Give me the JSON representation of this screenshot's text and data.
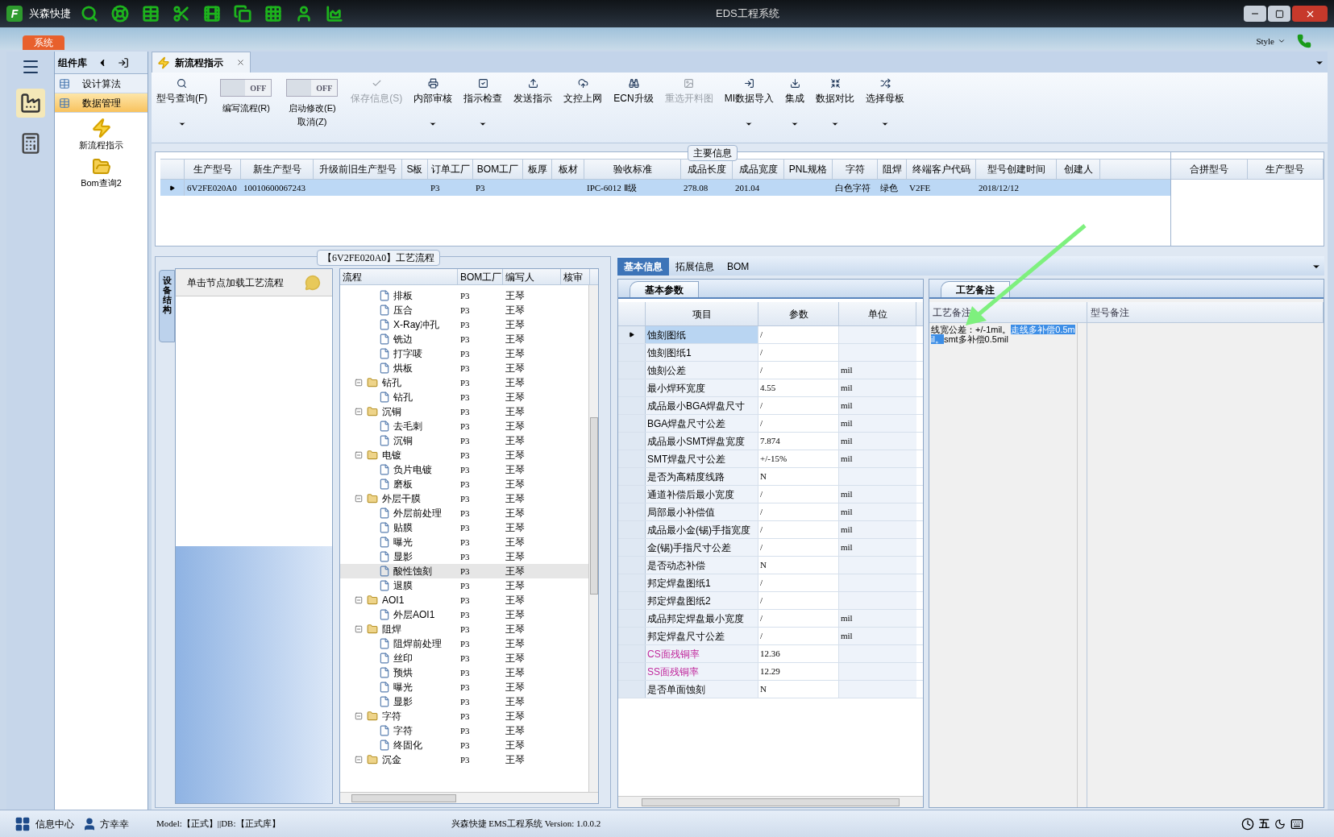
{
  "window": {
    "logo_text": "F",
    "app_name": "兴森快捷",
    "title": "EDS工程系统"
  },
  "menu": {
    "system_tab": "系统",
    "style_label": "Style"
  },
  "components": {
    "title": "组件库",
    "items": [
      {
        "label": "设计算法",
        "selected": false
      },
      {
        "label": "数据管理",
        "selected": true
      }
    ],
    "tools": [
      "新流程指示",
      "Bom查询2"
    ]
  },
  "doc_tab": {
    "label": "新流程指示"
  },
  "toolbar": [
    {
      "kind": "button",
      "label": "型号查询(F)",
      "disabled": false,
      "dropdown": true
    },
    {
      "kind": "toggle",
      "label": "编写流程(R)",
      "on": false,
      "state_text": "OFF"
    },
    {
      "kind": "toggle",
      "label": "启动修改(E)",
      "label2": "取消(Z)",
      "on": false,
      "state_text": "OFF"
    },
    {
      "kind": "button",
      "label": "保存信息(S)",
      "disabled": true,
      "dropdown": false
    },
    {
      "kind": "button",
      "label": "内部审核",
      "disabled": false,
      "dropdown": true
    },
    {
      "kind": "button",
      "label": "指示检查",
      "disabled": false,
      "dropdown": true
    },
    {
      "kind": "button",
      "label": "发送指示",
      "disabled": false,
      "dropdown": false
    },
    {
      "kind": "button",
      "label": "文控上网",
      "disabled": false,
      "dropdown": false
    },
    {
      "kind": "button",
      "label": "ECN升级",
      "disabled": false,
      "dropdown": false
    },
    {
      "kind": "button",
      "label": "重选开料图",
      "disabled": true,
      "dropdown": false
    },
    {
      "kind": "button",
      "label": "MI数据导入",
      "disabled": false,
      "dropdown": true
    },
    {
      "kind": "button",
      "label": "集成",
      "disabled": false,
      "dropdown": true
    },
    {
      "kind": "button",
      "label": "数据对比",
      "disabled": false,
      "dropdown": true
    },
    {
      "kind": "button",
      "label": "选择母板",
      "disabled": false,
      "dropdown": true
    }
  ],
  "main_info": {
    "title": "主要信息",
    "columns": [
      "生产型号",
      "新生产型号",
      "升级前旧生产型号",
      "S板",
      "订单工厂",
      "BOM工厂",
      "板厚",
      "板材",
      "验收标准",
      "成品长度",
      "成品宽度",
      "PNL规格",
      "字符",
      "阻焊",
      "终端客户代码",
      "型号创建时间",
      "创建人"
    ],
    "rows": [
      {
        "selected": true,
        "cells": [
          "6V2FE020A0",
          "10010600067243",
          null,
          null,
          "P3",
          "P3",
          null,
          null,
          "IPC-6012 Ⅱ级",
          "278.08",
          "201.04",
          null,
          "白色字符",
          "绿色",
          "V2FE",
          "2018/12/12",
          null
        ]
      }
    ],
    "side_columns": [
      "合拼型号",
      "生产型号"
    ]
  },
  "flow": {
    "title": "【6V2FE020A0】工艺流程",
    "side_tab": "设备结构",
    "hint": "单击节点加载工艺流程",
    "columns": [
      "流程",
      "BOM工厂",
      "编写人",
      "核审"
    ],
    "tree": [
      {
        "kind": "file",
        "label": "排板",
        "bom": "P3",
        "writer": "王琴",
        "selected": false
      },
      {
        "kind": "file",
        "label": "压合",
        "bom": "P3",
        "writer": "王琴",
        "selected": false
      },
      {
        "kind": "file",
        "label": "X-Ray冲孔",
        "bom": "P3",
        "writer": "王琴",
        "selected": false
      },
      {
        "kind": "file",
        "label": "铣边",
        "bom": "P3",
        "writer": "王琴",
        "selected": false
      },
      {
        "kind": "file",
        "label": "打字唛",
        "bom": "P3",
        "writer": "王琴",
        "selected": false
      },
      {
        "kind": "file",
        "label": "烘板",
        "bom": "P3",
        "writer": "王琴",
        "selected": false
      },
      {
        "kind": "folder",
        "label": "钻孔",
        "bom": "P3",
        "writer": "王琴",
        "selected": false,
        "expanded": true,
        "children": [
          {
            "kind": "file",
            "label": "钻孔",
            "bom": "P3",
            "writer": "王琴",
            "selected": false
          }
        ]
      },
      {
        "kind": "folder",
        "label": "沉铜",
        "bom": "P3",
        "writer": "王琴",
        "selected": false,
        "expanded": true,
        "children": [
          {
            "kind": "file",
            "label": "去毛刺",
            "bom": "P3",
            "writer": "王琴",
            "selected": false
          },
          {
            "kind": "file",
            "label": "沉铜",
            "bom": "P3",
            "writer": "王琴",
            "selected": false
          }
        ]
      },
      {
        "kind": "folder",
        "label": "电镀",
        "bom": "P3",
        "writer": "王琴",
        "selected": false,
        "expanded": true,
        "children": [
          {
            "kind": "file",
            "label": "负片电镀",
            "bom": "P3",
            "writer": "王琴",
            "selected": false
          },
          {
            "kind": "file",
            "label": "磨板",
            "bom": "P3",
            "writer": "王琴",
            "selected": false
          }
        ]
      },
      {
        "kind": "folder",
        "label": "外层干膜",
        "bom": "P3",
        "writer": "王琴",
        "selected": false,
        "expanded": true,
        "children": [
          {
            "kind": "file",
            "label": "外层前处理",
            "bom": "P3",
            "writer": "王琴",
            "selected": false
          },
          {
            "kind": "file",
            "label": "贴膜",
            "bom": "P3",
            "writer": "王琴",
            "selected": false
          },
          {
            "kind": "file",
            "label": "曝光",
            "bom": "P3",
            "writer": "王琴",
            "selected": false
          },
          {
            "kind": "file",
            "label": "显影",
            "bom": "P3",
            "writer": "王琴",
            "selected": false
          },
          {
            "kind": "file",
            "label": "酸性蚀刻",
            "bom": "P3",
            "writer": "王琴",
            "selected": true
          },
          {
            "kind": "file",
            "label": "退膜",
            "bom": "P3",
            "writer": "王琴",
            "selected": false
          }
        ]
      },
      {
        "kind": "folder",
        "label": "AOI1",
        "bom": "P3",
        "writer": "王琴",
        "selected": false,
        "expanded": true,
        "children": [
          {
            "kind": "file",
            "label": "外层AOI1",
            "bom": "P3",
            "writer": "王琴",
            "selected": false
          }
        ]
      },
      {
        "kind": "folder",
        "label": "阻焊",
        "bom": "P3",
        "writer": "王琴",
        "selected": false,
        "expanded": true,
        "children": [
          {
            "kind": "file",
            "label": "阻焊前处理",
            "bom": "P3",
            "writer": "王琴",
            "selected": false
          },
          {
            "kind": "file",
            "label": "丝印",
            "bom": "P3",
            "writer": "王琴",
            "selected": false
          },
          {
            "kind": "file",
            "label": "预烘",
            "bom": "P3",
            "writer": "王琴",
            "selected": false
          },
          {
            "kind": "file",
            "label": "曝光",
            "bom": "P3",
            "writer": "王琴",
            "selected": false
          },
          {
            "kind": "file",
            "label": "显影",
            "bom": "P3",
            "writer": "王琴",
            "selected": false
          }
        ]
      },
      {
        "kind": "folder",
        "label": "字符",
        "bom": "P3",
        "writer": "王琴",
        "selected": false,
        "expanded": true,
        "children": [
          {
            "kind": "file",
            "label": "字符",
            "bom": "P3",
            "writer": "王琴",
            "selected": false
          },
          {
            "kind": "file",
            "label": "终固化",
            "bom": "P3",
            "writer": "王琴",
            "selected": false
          }
        ]
      },
      {
        "kind": "folder",
        "label": "沉金",
        "bom": "P3",
        "writer": "王琴",
        "selected": false,
        "expanded": true
      }
    ]
  },
  "detail_tabs": [
    {
      "label": "基本信息",
      "selected": true
    },
    {
      "label": "拓展信息",
      "selected": false
    },
    {
      "label": "BOM",
      "selected": false
    }
  ],
  "params": {
    "title": "基本参数",
    "columns": [
      "项目",
      "参数",
      "单位"
    ],
    "rows": [
      {
        "item": "蚀刻图纸",
        "value": "/",
        "selected": true
      },
      {
        "item": "蚀刻图纸1",
        "value": "/",
        "selected": false
      },
      {
        "item": "蚀刻公差",
        "value": "/",
        "unit": "mil",
        "selected": false
      },
      {
        "item": "最小焊环宽度",
        "value": "4.55",
        "unit": "mil",
        "selected": false
      },
      {
        "item": "成品最小BGA焊盘尺寸",
        "value": "/",
        "unit": "mil",
        "selected": false
      },
      {
        "item": "BGA焊盘尺寸公差",
        "value": "/",
        "unit": "mil",
        "selected": false
      },
      {
        "item": "成品最小SMT焊盘宽度",
        "value": "7.874",
        "unit": "mil",
        "selected": false
      },
      {
        "item": "SMT焊盘尺寸公差",
        "value": "+/-15%",
        "unit": "mil",
        "selected": false
      },
      {
        "item": "是否为高精度线路",
        "value": "N",
        "selected": false
      },
      {
        "item": "通道补偿后最小宽度",
        "value": "/",
        "unit": "mil",
        "selected": false
      },
      {
        "item": "局部最小补偿值",
        "value": "/",
        "unit": "mil",
        "selected": false
      },
      {
        "item": "成品最小金(锡)手指宽度",
        "value": "/",
        "unit": "mil",
        "selected": false
      },
      {
        "item": "金(锡)手指尺寸公差",
        "value": "/",
        "unit": "mil",
        "selected": false
      },
      {
        "item": "是否动态补偿",
        "value": "N",
        "selected": false
      },
      {
        "item": "邦定焊盘图纸1",
        "value": "/",
        "selected": false
      },
      {
        "item": "邦定焊盘图纸2",
        "value": "/",
        "selected": false
      },
      {
        "item": "成品邦定焊盘最小宽度",
        "value": "/",
        "unit": "mil",
        "selected": false
      },
      {
        "item": "邦定焊盘尺寸公差",
        "value": "/",
        "unit": "mil",
        "selected": false
      },
      {
        "item": "CS面残铜率",
        "value": "12.36",
        "color": "#c0289c",
        "selected": false
      },
      {
        "item": "SS面残铜率",
        "value": "12.29",
        "color": "#c0289c",
        "selected": false
      },
      {
        "item": "是否单面蚀刻",
        "value": "N",
        "selected": false
      }
    ]
  },
  "remarks": {
    "title": "工艺备注",
    "columns": [
      "工艺备注",
      "型号备注"
    ],
    "text": [
      {
        "text": "线宽公差：+/-1mil。",
        "highlighted": false
      },
      {
        "text": "走线多补偿0.5mil。",
        "highlighted": true
      },
      {
        "text": "smt多补偿0.5mil",
        "highlighted": false
      }
    ]
  },
  "status_bar": {
    "info_center": "信息中心",
    "user": "方幸幸",
    "model": "Model:【正式】||DB:【正式库】",
    "version": "兴森快捷 EMS工程系统 Version: 1.0.0.2",
    "ime": "五"
  }
}
